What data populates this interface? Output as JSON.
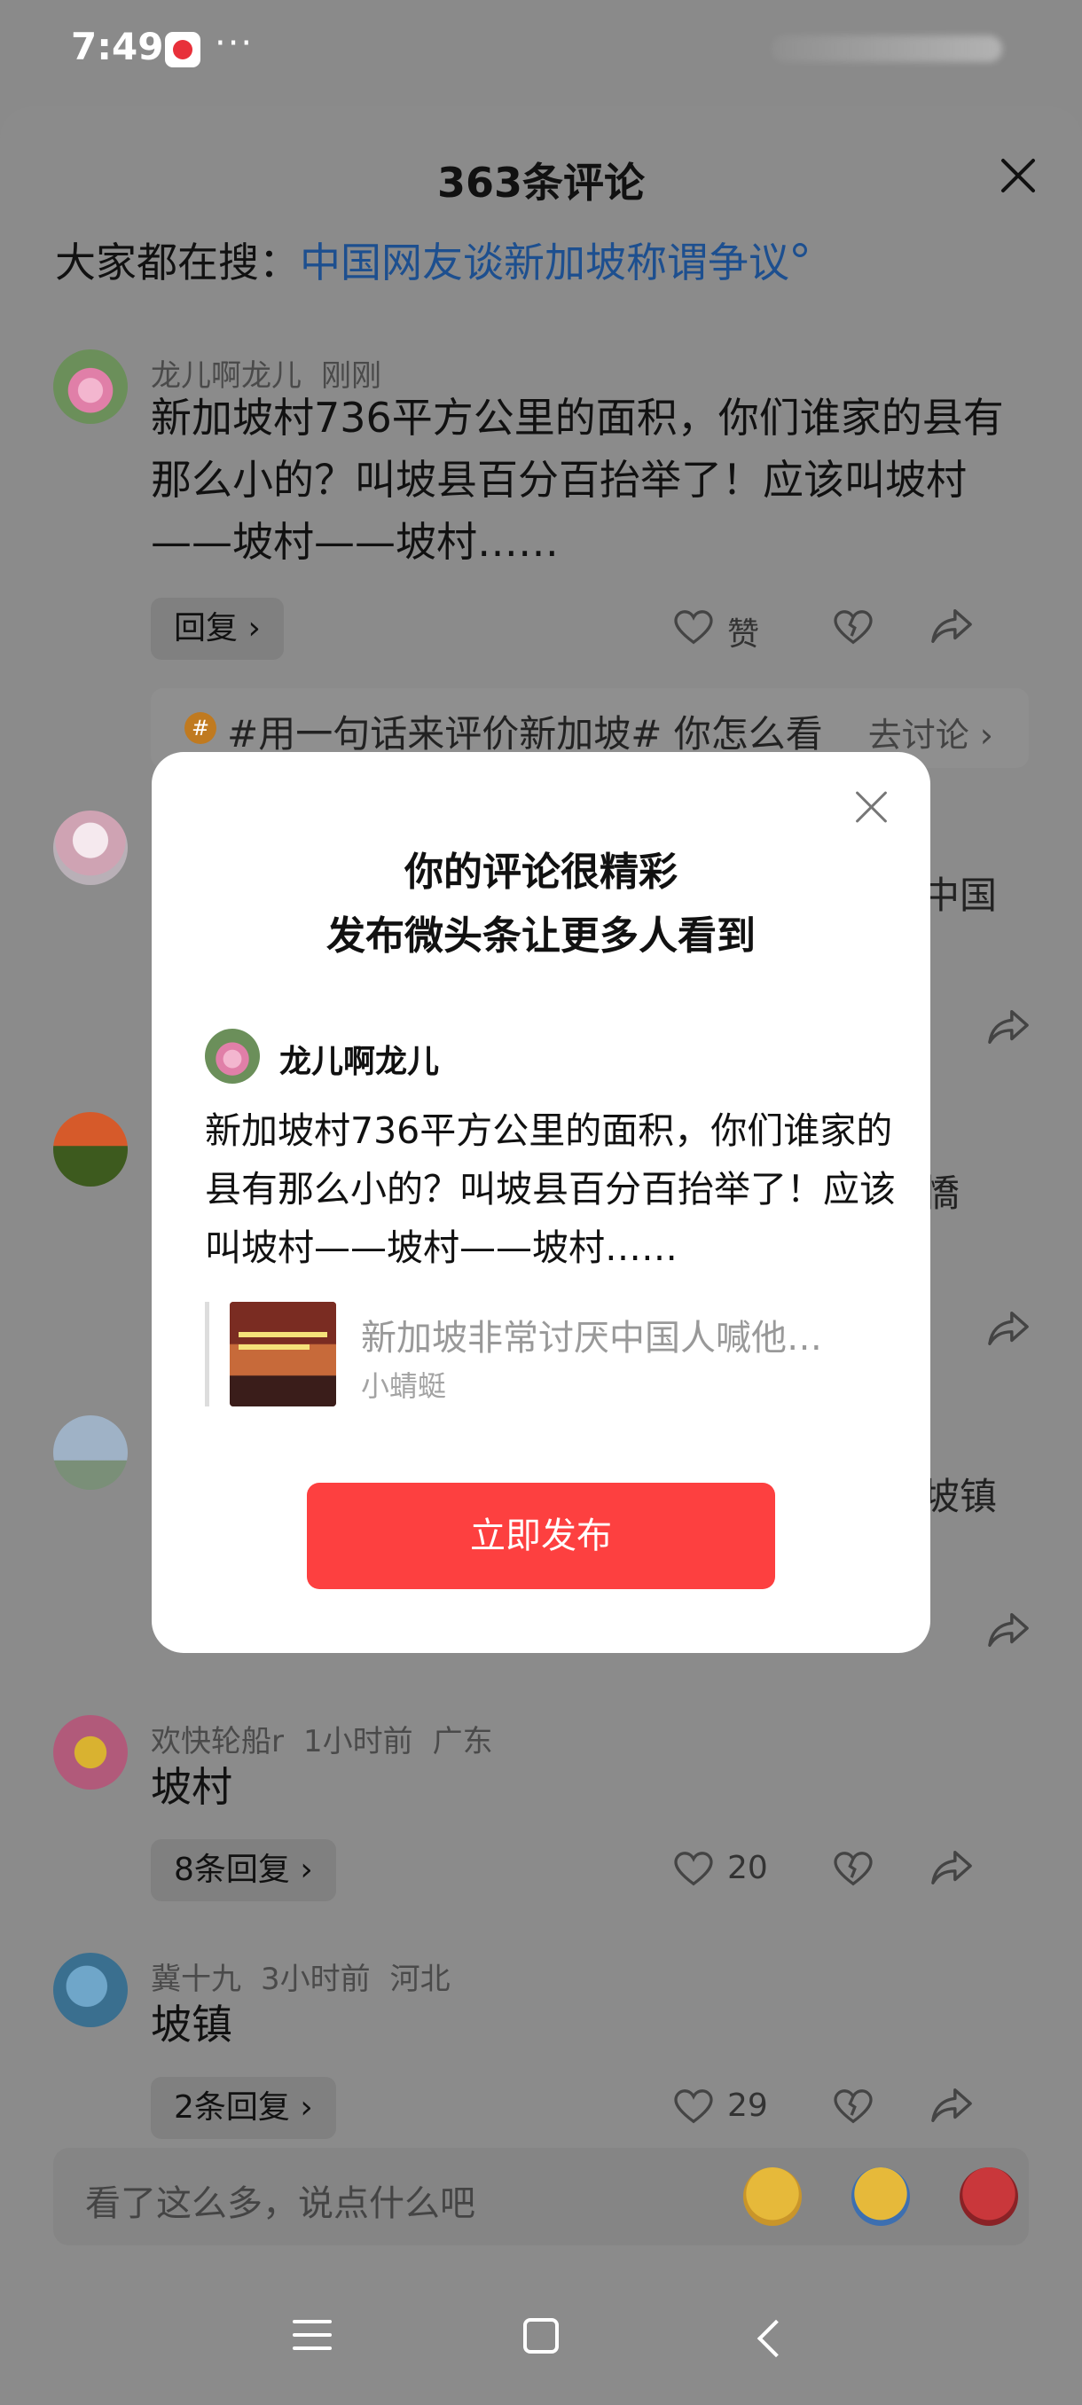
{
  "status_bar": {
    "time": "7:49",
    "more": "···"
  },
  "sheet": {
    "title": "363条评论",
    "search_prefix": "大家都在搜：",
    "search_link": "中国网友谈新加坡称谓争议"
  },
  "comments": [
    {
      "user": "龙儿啊龙儿",
      "time": "刚刚",
      "text": "新加坡村736平方公里的面积，你们谁家的县有那么小的？叫坡县百分百抬举了！应该叫坡村——坡村——坡村……",
      "reply_label": "回复 ›",
      "like_label": "赞"
    },
    {
      "user": "欢快轮船r",
      "time": "1小时前",
      "location": "广东",
      "text": "坡村",
      "reply_label": "8条回复 ›",
      "like_label": "20"
    },
    {
      "user": "冀十九",
      "time": "3小时前",
      "location": "河北",
      "text": "坡镇",
      "reply_label": "2条回复 ›",
      "like_label": "29"
    }
  ],
  "topic": {
    "text": "#用一句话来评价新加坡# 你怎么看",
    "action": "去讨论 ›"
  },
  "peeks": {
    "p1": "中国",
    "p2": "憍",
    "p3": "坡镇"
  },
  "modal": {
    "title_line1": "你的评论很精彩",
    "title_line2": "发布微头条让更多人看到",
    "user": "龙儿啊龙儿",
    "text": "新加坡村736平方公里的面积，你们谁家的县有那么小的？叫坡县百分百抬举了！应该叫坡村——坡村——坡村……",
    "quote_title": "新加坡非常讨厌中国人喊他…",
    "quote_author": "小蜻蜓",
    "publish_button": "立即发布"
  },
  "input": {
    "placeholder": "看了这么多，说点什么吧"
  },
  "icons": {
    "like": "heart-icon",
    "dislike": "broken-heart-icon",
    "share": "share-arrow-icon",
    "close": "close-icon"
  },
  "colors": {
    "accent_red": "#fd4040",
    "link_blue": "#1d4f8f"
  }
}
